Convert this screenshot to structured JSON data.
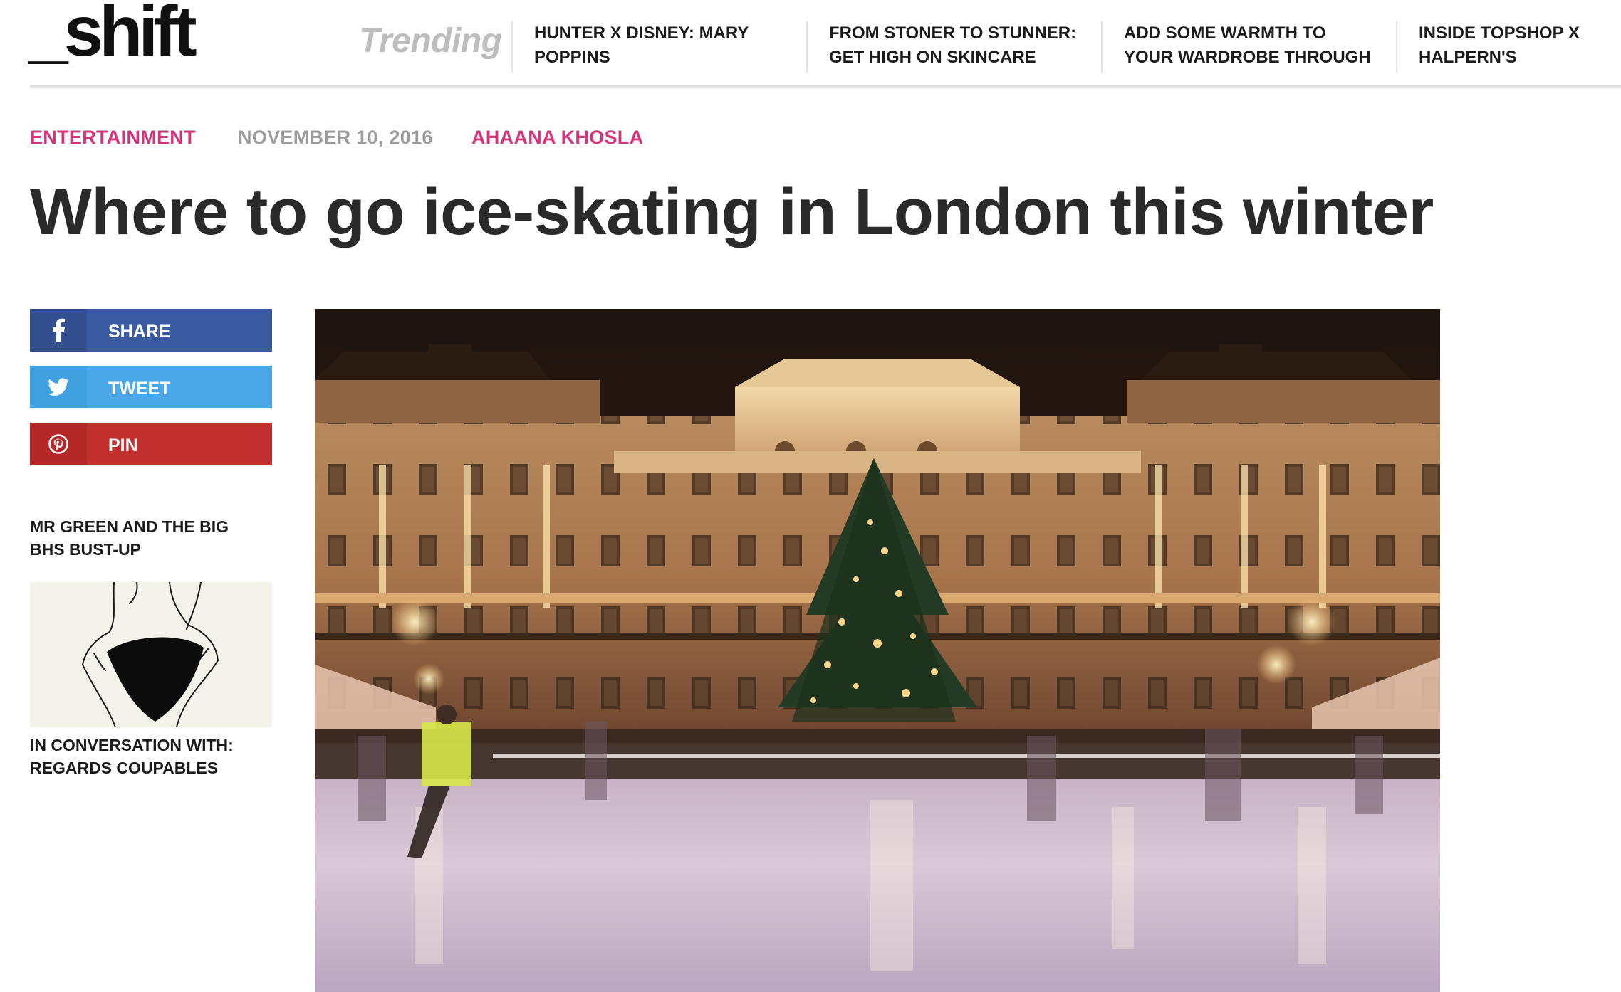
{
  "header": {
    "logo_text": "_shift",
    "trending_label": "Trending",
    "trending_items": [
      {
        "line1": "HUNTER X DISNEY: MARY",
        "line2": "POPPINS"
      },
      {
        "line1": "FROM STONER TO STUNNER:",
        "line2": "GET HIGH ON SKINCARE"
      },
      {
        "line1": "ADD SOME WARMTH TO",
        "line2": "YOUR WARDROBE THROUGH"
      },
      {
        "line1": "INSIDE TOPSHOP X",
        "line2": "HALPERN'S"
      }
    ]
  },
  "article": {
    "category": "ENTERTAINMENT",
    "date": "NOVEMBER 10, 2016",
    "author": "AHAANA KHOSLA",
    "title": "Where to go ice-skating in London this winter"
  },
  "share": {
    "facebook_label": "SHARE",
    "twitter_label": "TWEET",
    "pinterest_label": "PIN"
  },
  "related": [
    {
      "title_line1": "MR GREEN AND THE BIG",
      "title_line2": "BHS BUST-UP"
    },
    {
      "title_line1": "IN CONVERSATION WITH:",
      "title_line2": "REGARDS COUPABLES"
    }
  ],
  "colors": {
    "accent_pink": "#d6347a",
    "facebook": "#3b5ba0",
    "twitter": "#4aa8e8",
    "pinterest": "#c12f2f"
  },
  "icons": [
    "facebook-icon",
    "twitter-icon",
    "pinterest-icon"
  ]
}
